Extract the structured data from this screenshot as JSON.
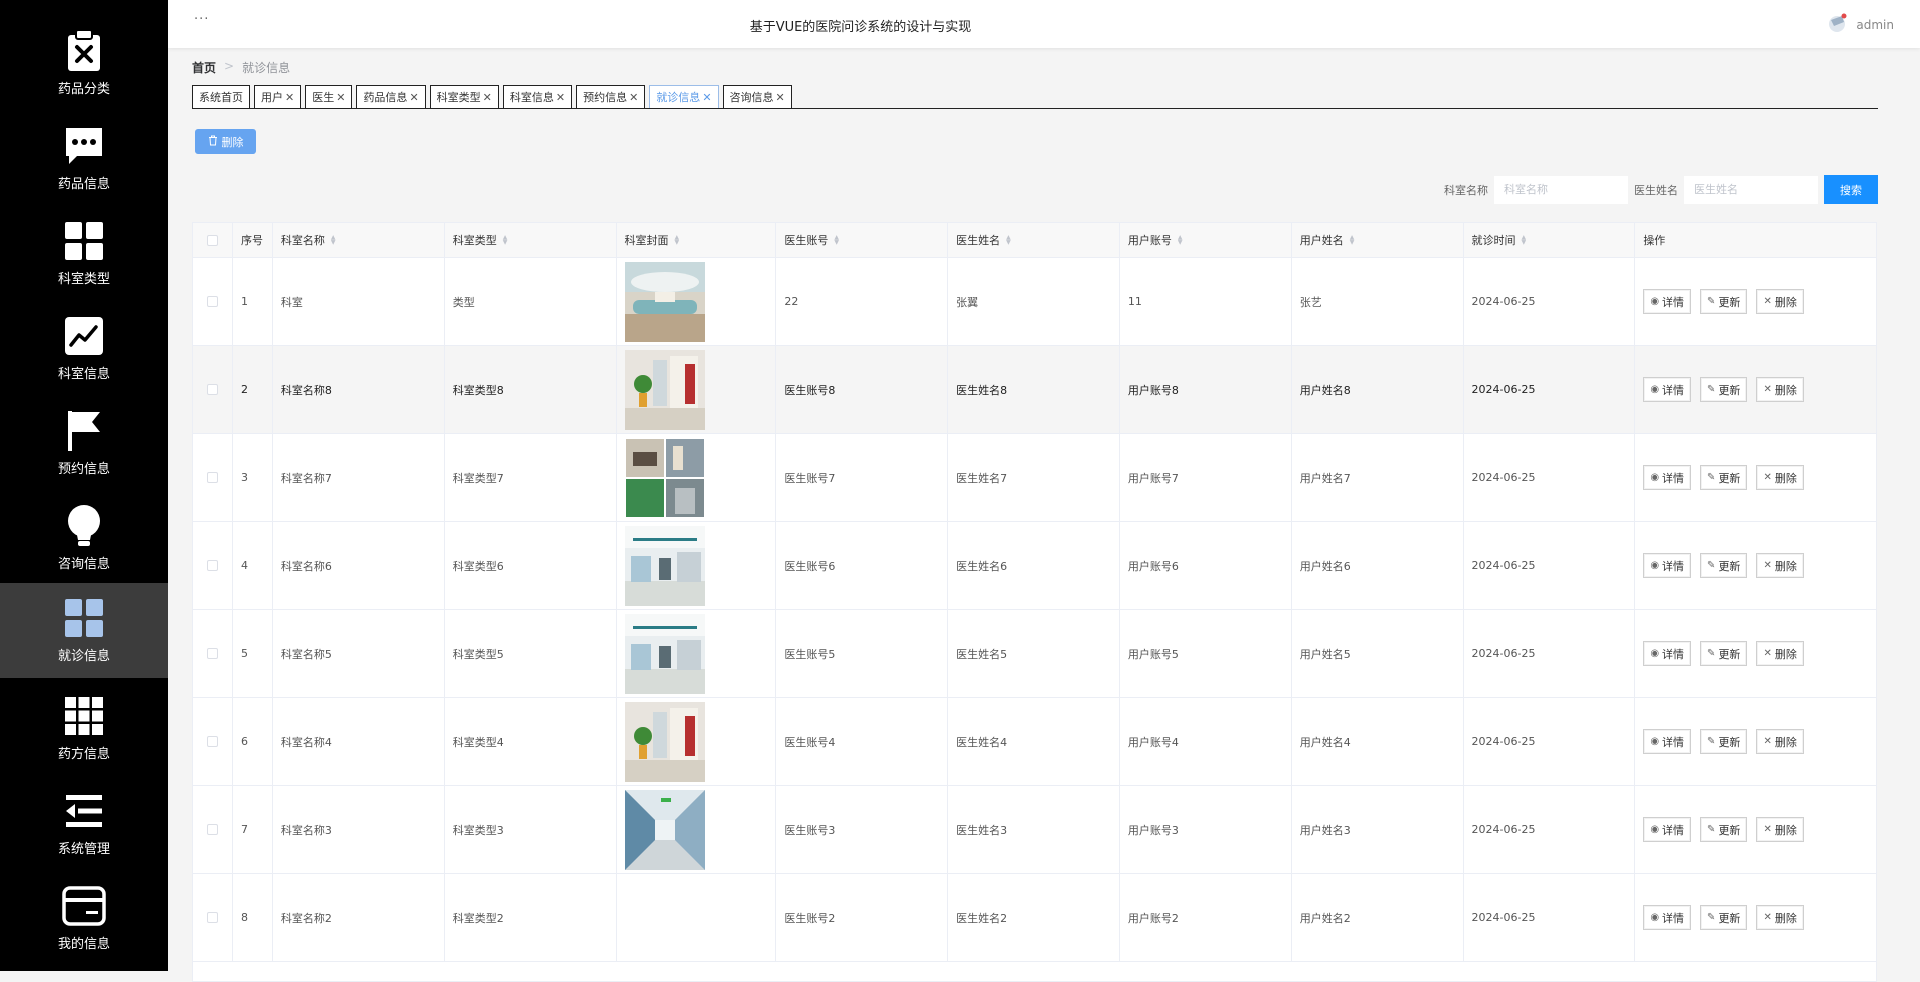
{
  "header": {
    "dots": "···",
    "title": "基于VUE的医院问诊系统的设计与实现",
    "user_name": "admin"
  },
  "sidebar": {
    "items": [
      {
        "label": "药品分类",
        "icon": "clipboard-x-icon"
      },
      {
        "label": "药品信息",
        "icon": "chat-bubble-icon"
      },
      {
        "label": "科室类型",
        "icon": "grid-four-icon"
      },
      {
        "label": "科室信息",
        "icon": "trend-chart-icon"
      },
      {
        "label": "预约信息",
        "icon": "flag-icon"
      },
      {
        "label": "咨询信息",
        "icon": "lightbulb-icon"
      },
      {
        "label": "就诊信息",
        "icon": "grid-four-icon",
        "active": true
      },
      {
        "label": "药方信息",
        "icon": "grid-nine-icon"
      },
      {
        "label": "系统管理",
        "icon": "menu-arrow-icon"
      },
      {
        "label": "我的信息",
        "icon": "card-icon"
      }
    ]
  },
  "breadcrumb": {
    "home": "首页",
    "separator": ">",
    "current": "就诊信息"
  },
  "tabs": [
    {
      "label": "系统首页",
      "closable": false
    },
    {
      "label": "用户",
      "closable": true
    },
    {
      "label": "医生",
      "closable": true
    },
    {
      "label": "药品信息",
      "closable": true
    },
    {
      "label": "科室类型",
      "closable": true
    },
    {
      "label": "科室信息",
      "closable": true
    },
    {
      "label": "预约信息",
      "closable": true
    },
    {
      "label": "就诊信息",
      "closable": true,
      "active": true
    },
    {
      "label": "咨询信息",
      "closable": true
    }
  ],
  "toolbar": {
    "batch_delete_label": "删除"
  },
  "search": {
    "dept_label": "科室名称",
    "dept_placeholder": "科室名称",
    "doctor_label": "医生姓名",
    "doctor_placeholder": "医生姓名",
    "button_label": "搜索"
  },
  "table": {
    "columns": [
      "序号",
      "科室名称",
      "科室类型",
      "科室封面",
      "医生账号",
      "医生姓名",
      "用户账号",
      "用户姓名",
      "就诊时间",
      "操作"
    ],
    "actions": {
      "detail": "详情",
      "update": "更新",
      "delete": "删除"
    },
    "rows": [
      {
        "index": "1",
        "dept_name": "科室",
        "dept_type": "类型",
        "cover": "lobby",
        "doctor_account": "22",
        "doctor_name": "张翼",
        "user_account": "11",
        "user_name": "张艺",
        "visit_time": "2024-06-25"
      },
      {
        "index": "2",
        "dept_name": "科室名称8",
        "dept_type": "科室类型8",
        "cover": "ward",
        "doctor_account": "医生账号8",
        "doctor_name": "医生姓名8",
        "user_account": "用户账号8",
        "user_name": "用户姓名8",
        "visit_time": "2024-06-25"
      },
      {
        "index": "3",
        "dept_name": "科室名称7",
        "dept_type": "科室类型7",
        "cover": "collage",
        "doctor_account": "医生账号7",
        "doctor_name": "医生姓名7",
        "user_account": "用户账号7",
        "user_name": "用户姓名7",
        "visit_time": "2024-06-25"
      },
      {
        "index": "4",
        "dept_name": "科室名称6",
        "dept_type": "科室类型6",
        "cover": "corridor",
        "doctor_account": "医生账号6",
        "doctor_name": "医生姓名6",
        "user_account": "用户账号6",
        "user_name": "用户姓名6",
        "visit_time": "2024-06-25"
      },
      {
        "index": "5",
        "dept_name": "科室名称5",
        "dept_type": "科室类型5",
        "cover": "corridor",
        "doctor_account": "医生账号5",
        "doctor_name": "医生姓名5",
        "user_account": "用户账号5",
        "user_name": "用户姓名5",
        "visit_time": "2024-06-25"
      },
      {
        "index": "6",
        "dept_name": "科室名称4",
        "dept_type": "科室类型4",
        "cover": "ward",
        "doctor_account": "医生账号4",
        "doctor_name": "医生姓名4",
        "user_account": "用户账号4",
        "user_name": "用户姓名4",
        "visit_time": "2024-06-25"
      },
      {
        "index": "7",
        "dept_name": "科室名称3",
        "dept_type": "科室类型3",
        "cover": "hallway",
        "doctor_account": "医生账号3",
        "doctor_name": "医生姓名3",
        "user_account": "用户账号3",
        "user_name": "用户姓名3",
        "visit_time": "2024-06-25"
      },
      {
        "index": "8",
        "dept_name": "科室名称2",
        "dept_type": "科室类型2",
        "cover": "",
        "doctor_account": "医生账号2",
        "doctor_name": "医生姓名2",
        "user_account": "用户账号2",
        "user_name": "用户姓名2",
        "visit_time": "2024-06-25"
      }
    ]
  },
  "colors": {
    "sidebar_bg": "#000000",
    "sidebar_active": "#3c3c3c",
    "accent": "#1890ff",
    "active_tab": "#5b9ae8",
    "batch_delete_bg": "#66a4f0"
  }
}
